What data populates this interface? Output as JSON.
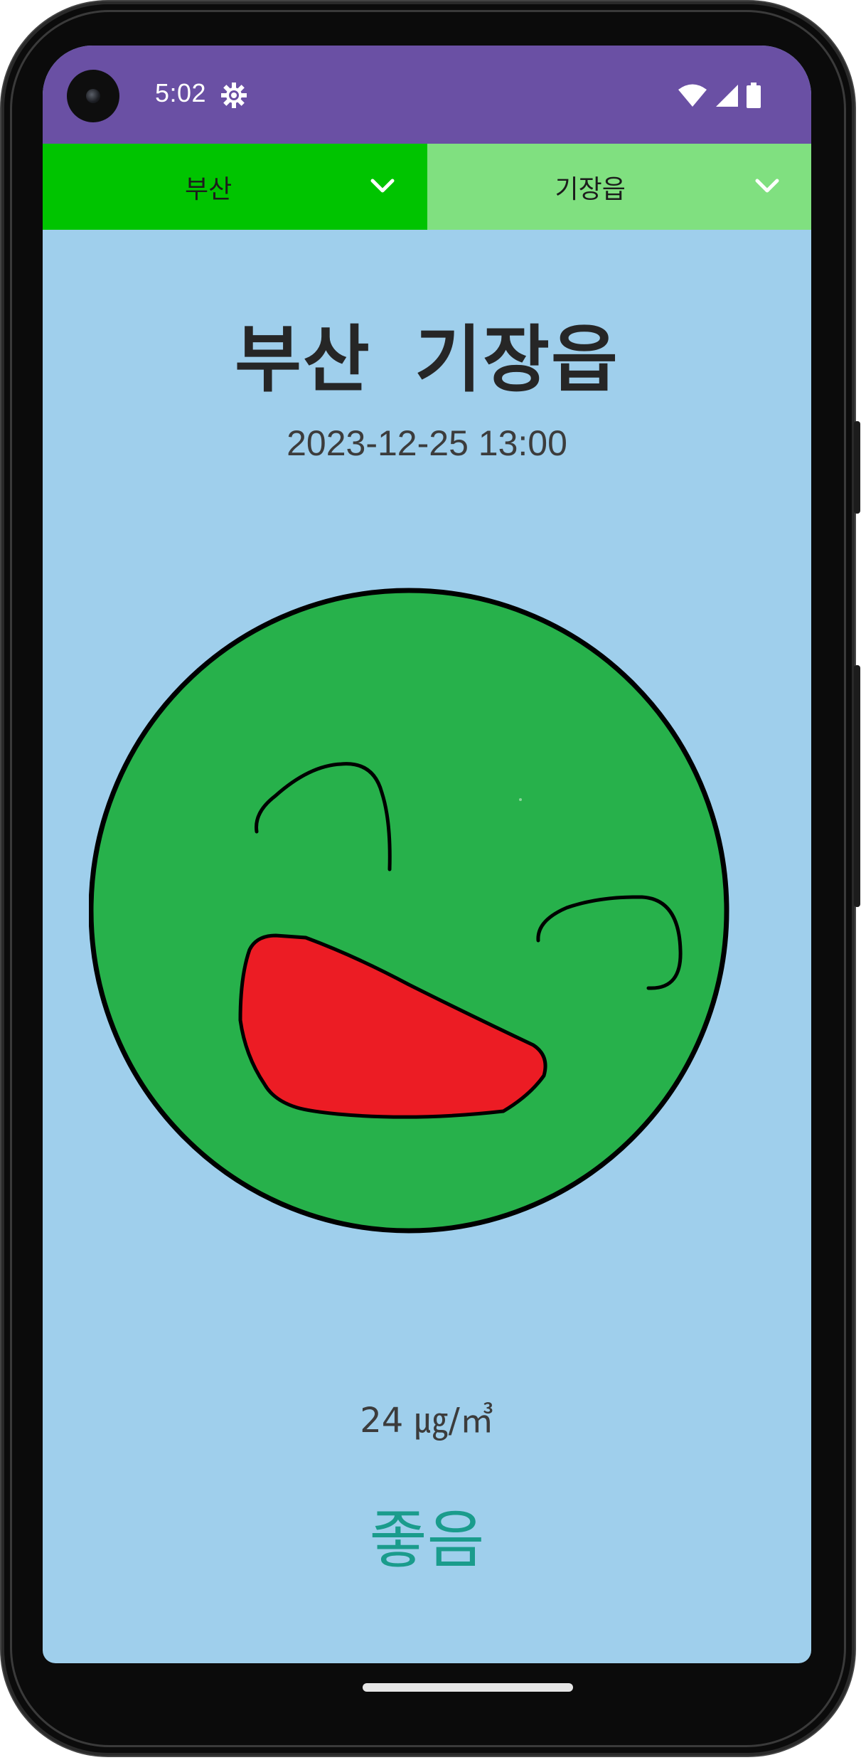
{
  "status_bar": {
    "time": "5:02",
    "icons": [
      "gear-icon",
      "wifi-icon",
      "signal-icon",
      "battery-icon"
    ],
    "color": "#6a50a4"
  },
  "selectors": {
    "province": {
      "value": "부산",
      "color": "#00c400"
    },
    "district": {
      "value": "기장읍",
      "color": "#80e080"
    }
  },
  "main": {
    "title": "부산 기장읍",
    "timestamp": "2023-12-25 13:00",
    "face_icon": "happy-face-icon",
    "pm_value": "24 ㎍/㎥",
    "grade": "좋음",
    "grade_color": "#1a9c8c",
    "background_color": "#9fcfec",
    "face_color": "#27b14b"
  }
}
